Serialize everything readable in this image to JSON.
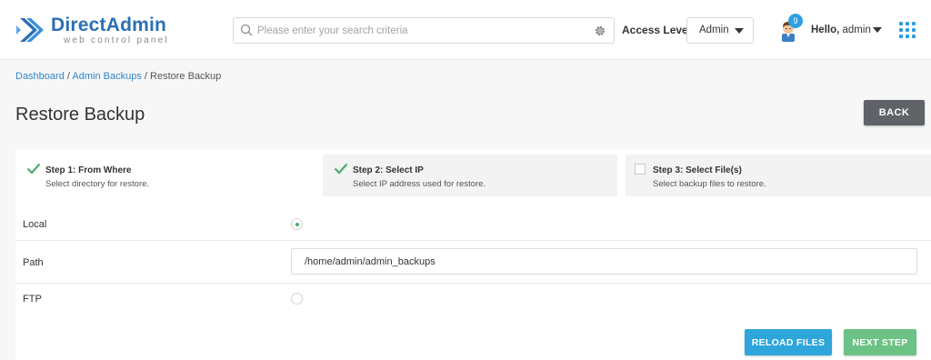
{
  "colors": {
    "brand": "#2b6fb6",
    "accent": "#2e9fe0",
    "success": "#6cc284",
    "back": "#5f6368"
  },
  "header": {
    "logo_title": "DirectAdmin",
    "logo_subtitle": "web control panel",
    "search_placeholder": "Please enter your search criteria",
    "access_level_label": "Access Level",
    "access_level_value": "Admin",
    "notification_count": "9",
    "greeting": "Hello,",
    "username": "admin"
  },
  "breadcrumb": {
    "items": [
      "Dashboard",
      "Admin Backups"
    ],
    "separator": "/",
    "current": "Restore Backup"
  },
  "page": {
    "title": "Restore Backup",
    "back_label": "BACK"
  },
  "steps": [
    {
      "title": "Step 1: From Where",
      "description": "Select directory for restore.",
      "done": true
    },
    {
      "title": "Step 2: Select IP",
      "description": "Select IP address used for restore.",
      "done": true
    },
    {
      "title": "Step 3: Select File(s)",
      "description": "Select backup files to restore.",
      "done": false
    }
  ],
  "form": {
    "local_label": "Local",
    "local_selected": true,
    "path_label": "Path",
    "path_value": "/home/admin/admin_backups",
    "ftp_label": "FTP",
    "ftp_selected": false
  },
  "actions": {
    "reload_label": "RELOAD FILES",
    "next_label": "NEXT STEP"
  }
}
